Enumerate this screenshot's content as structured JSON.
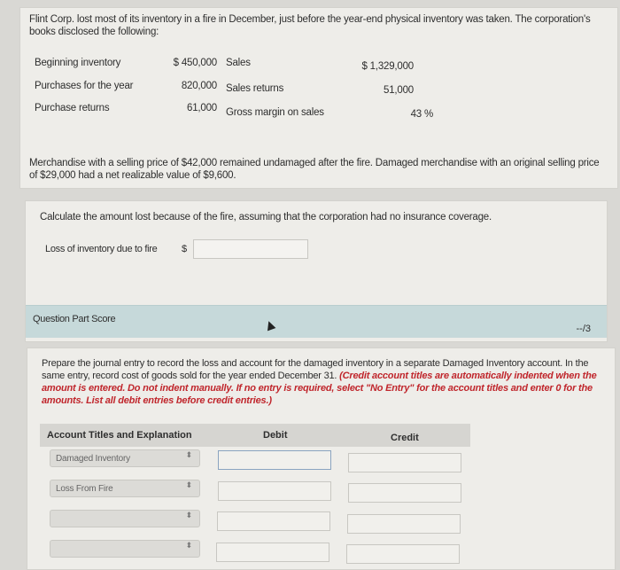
{
  "problem": {
    "intro": "Flint Corp. lost most of its inventory in a fire in December, just before the year-end physical inventory was taken. The corporation's books disclosed the following:",
    "left_items": [
      {
        "label": "Beginning inventory",
        "value": "$  450,000"
      },
      {
        "label": "Purchases for the year",
        "value": "820,000"
      },
      {
        "label": "Purchase returns",
        "value": "61,000"
      }
    ],
    "right_items": [
      {
        "label": "Sales",
        "value": "$  1,329,000"
      },
      {
        "label": "Sales returns",
        "value": "51,000"
      },
      {
        "label": "Gross margin on sales",
        "value": "43  %"
      }
    ],
    "merchandise_text": "Merchandise with a selling price of $42,000 remained undamaged after the fire. Damaged merchandise with an original selling price of $29,000 had a net realizable value of $9,600."
  },
  "part1": {
    "prompt": "Calculate the amount lost because of the fire, assuming that the corporation had no insurance coverage.",
    "loss_label": "Loss of inventory due to fire",
    "currency": "$",
    "loss_value": "",
    "score_label": "Question Part Score",
    "score_value": "--/3"
  },
  "part2": {
    "instruction_plain": "Prepare the journal entry to record the loss and account for the damaged inventory in a separate Damaged Inventory account. In the same entry, record cost of goods sold for the year ended December 31. ",
    "instruction_red": "(Credit account titles are automatically indented when the amount is entered. Do not indent manually. If no entry is required, select \"No Entry\" for the account titles and enter 0 for the amounts. List all debit entries before credit entries.)",
    "headers": {
      "account": "Account Titles and Explanation",
      "debit": "Debit",
      "credit": "Credit"
    },
    "rows": [
      {
        "account": "Damaged Inventory",
        "debit": "",
        "credit": ""
      },
      {
        "account": "Loss From Fire",
        "debit": "",
        "credit": ""
      },
      {
        "account": "",
        "debit": "",
        "credit": ""
      },
      {
        "account": "",
        "debit": "",
        "credit": ""
      }
    ]
  },
  "icons": {
    "select_arrow": "⬍"
  }
}
